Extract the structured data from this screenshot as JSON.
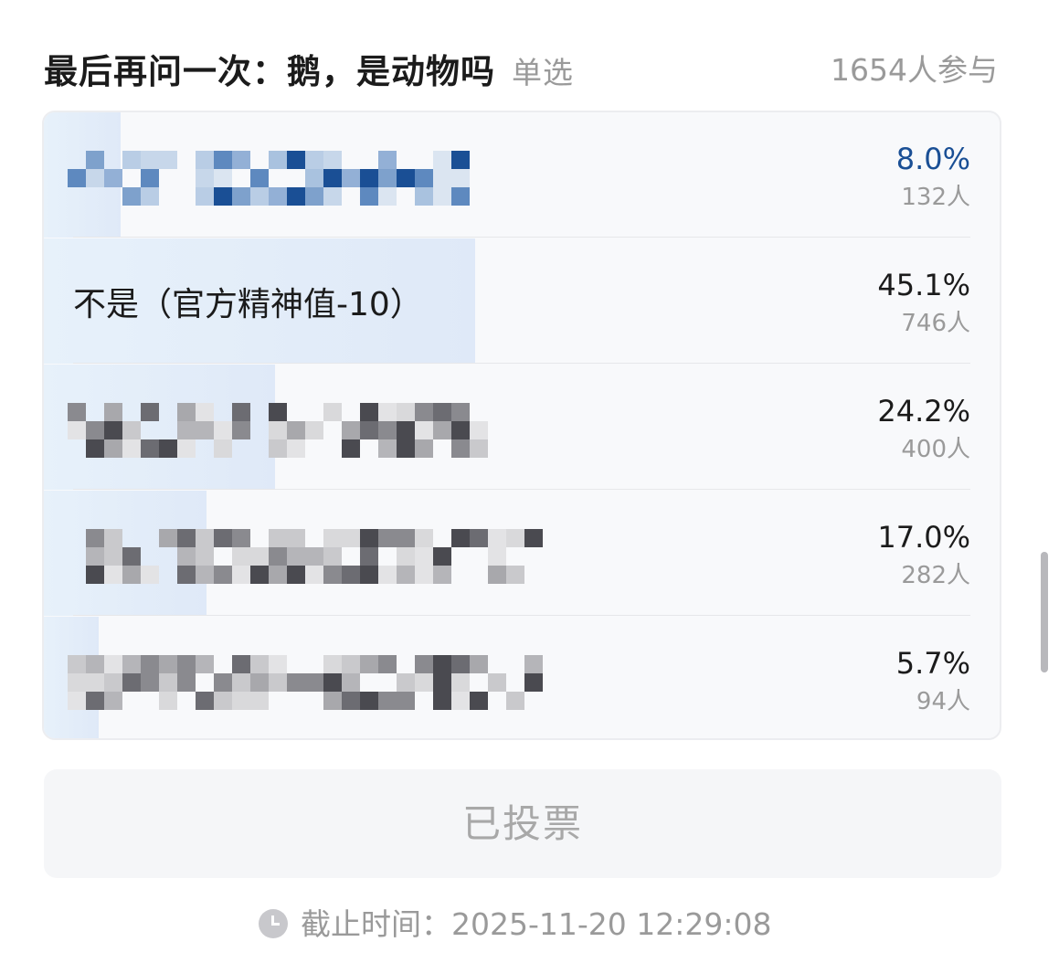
{
  "poll": {
    "title": "最后再问一次：鹅，是动物吗",
    "type_tag": "单选",
    "participants": "1654人参与",
    "options": [
      {
        "label": "",
        "percent": "8.0%",
        "count": "132人",
        "fraction": 0.08,
        "voted": true
      },
      {
        "label": "不是（官方精神值-10）",
        "percent": "45.1%",
        "count": "746人",
        "fraction": 0.451,
        "voted": false
      },
      {
        "label": "",
        "percent": "24.2%",
        "count": "400人",
        "fraction": 0.242,
        "voted": false
      },
      {
        "label": "",
        "percent": "17.0%",
        "count": "282人",
        "fraction": 0.17,
        "voted": false
      },
      {
        "label": "",
        "percent": "5.7%",
        "count": "94人",
        "fraction": 0.057,
        "voted": false
      }
    ],
    "vote_button": "已投票",
    "deadline": "截止时间：2025-11-20 12:29:08"
  },
  "colors": {
    "voted_accent": "#1a4f95",
    "fill": "#dfe9f8",
    "muted_text": "#9a9a9a"
  },
  "icons": {
    "deadline": "clock-icon"
  }
}
